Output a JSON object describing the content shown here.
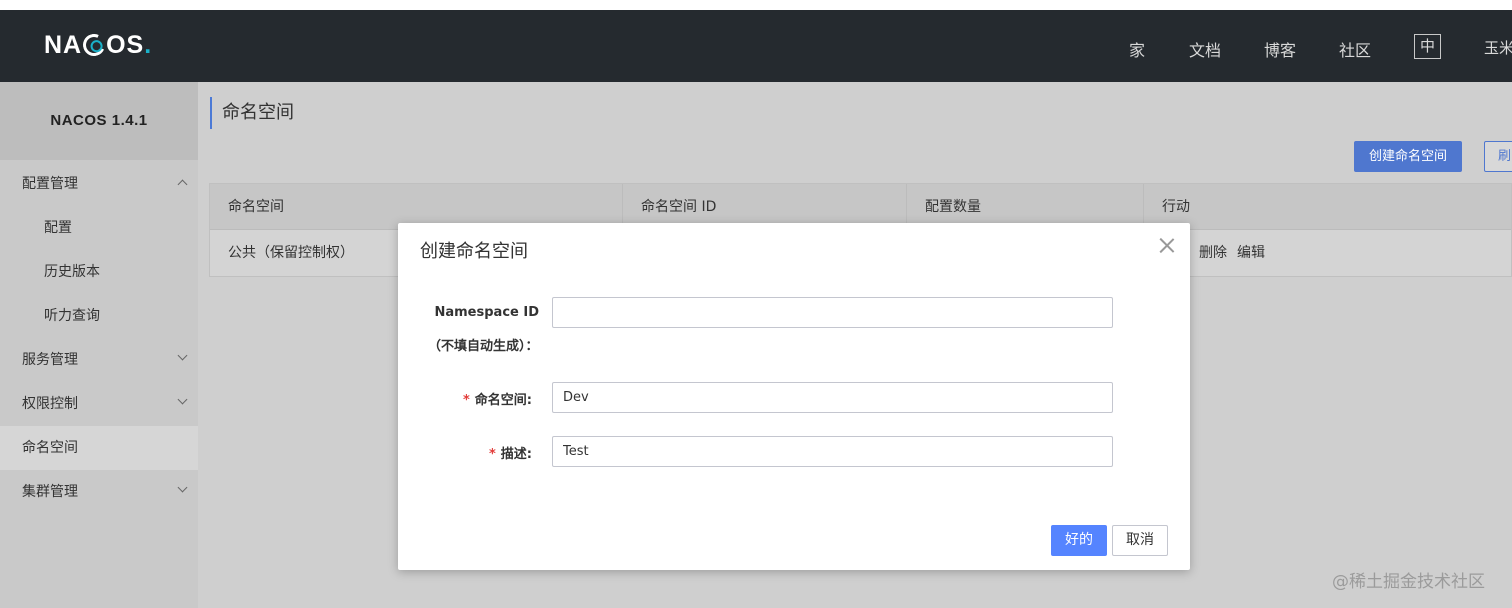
{
  "header": {
    "logo_main": "NA",
    "logo_tail": "OS",
    "logo_dot": ".",
    "nav": [
      "家",
      "文档",
      "博客",
      "社区"
    ],
    "lang": "中",
    "user": "玉米"
  },
  "sidebar": {
    "title": "NACOS  1.4.1",
    "items": [
      {
        "label": "配置管理"
      },
      {
        "label": "配置"
      },
      {
        "label": "历史版本"
      },
      {
        "label": "听力查询"
      },
      {
        "label": "服务管理"
      },
      {
        "label": "权限控制"
      },
      {
        "label": "命名空间"
      },
      {
        "label": "集群管理"
      }
    ]
  },
  "main": {
    "title": "命名空间",
    "create_button": "创建命名空间",
    "refresh_button": "刷",
    "table": {
      "columns": [
        "命名空间",
        "命名空间 ID",
        "配置数量",
        "行动"
      ],
      "rows": [
        {
          "name": "公共（保留控制权）",
          "delete": "删除",
          "edit": "编辑"
        }
      ]
    }
  },
  "dialog": {
    "title": "创建命名空间",
    "namespace_id_label_1": "Namespace ID",
    "namespace_id_label_2": "（不填自动生成）：",
    "namespace_id_value": "",
    "name_label": "命名空间:",
    "name_value": "Dev",
    "desc_label": "描述:",
    "desc_value": "Test",
    "required_mark": "*",
    "ok_button": "好的",
    "cancel_button": "取消"
  },
  "watermark": "@稀土掘金技术社区",
  "colors": {
    "header_bg": "#252a2f",
    "primary": "#5584ff",
    "required": "#e23c39"
  }
}
